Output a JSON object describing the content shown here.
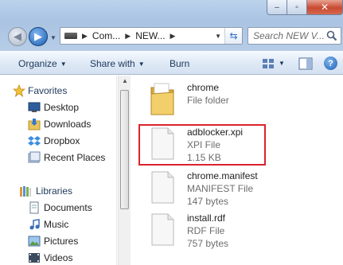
{
  "window": {
    "caption_buttons": [
      "–",
      "▫",
      "✕"
    ]
  },
  "address": {
    "segments": [
      "Com...",
      "NEW..."
    ],
    "search_placeholder": "Search NEW V..."
  },
  "toolbar": {
    "organize_label": "Organize",
    "share_label": "Share with",
    "burn_label": "Burn",
    "help_label": "?"
  },
  "nav": {
    "favorites_label": "Favorites",
    "favorites": [
      "Desktop",
      "Downloads",
      "Dropbox",
      "Recent Places"
    ],
    "libraries_label": "Libraries",
    "libraries": [
      "Documents",
      "Music",
      "Pictures",
      "Videos"
    ]
  },
  "files": [
    {
      "name": "chrome",
      "type": "File folder",
      "size": "",
      "icon": "folder-icon"
    },
    {
      "name": "adblocker.xpi",
      "type": "XPI File",
      "size": "1.15 KB",
      "icon": "file-icon"
    },
    {
      "name": "chrome.manifest",
      "type": "MANIFEST File",
      "size": "147 bytes",
      "icon": "file-icon"
    },
    {
      "name": "install.rdf",
      "type": "RDF File",
      "size": "757 bytes",
      "icon": "file-icon"
    }
  ],
  "colors": {
    "highlight": "#d9232c",
    "accent": "#1e5fb4"
  }
}
